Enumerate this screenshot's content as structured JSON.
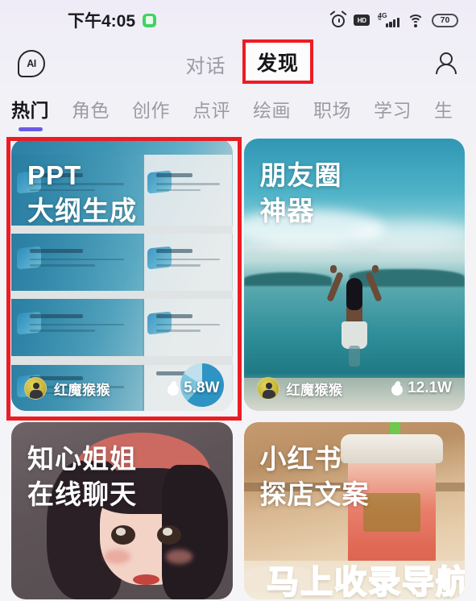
{
  "statusbar": {
    "time": "下午4:05",
    "app_badge_icon": "wechat-green-icon",
    "icons": [
      "alarm-icon",
      "hd-icon",
      "signal-4g-icon",
      "wifi-icon",
      "battery-icon"
    ],
    "network_label": "4G",
    "hd_label": "HD",
    "battery_level": "70"
  },
  "header": {
    "logo_text": "AI",
    "logo_icon": "ai-logo-icon",
    "profile_icon": "person-icon",
    "tabs": [
      {
        "label": "对话",
        "active": false
      },
      {
        "label": "发现",
        "active": true
      }
    ],
    "highlighted_tab": "发现"
  },
  "categories": [
    {
      "label": "热门",
      "active": true
    },
    {
      "label": "角色",
      "active": false
    },
    {
      "label": "创作",
      "active": false
    },
    {
      "label": "点评",
      "active": false
    },
    {
      "label": "绘画",
      "active": false
    },
    {
      "label": "职场",
      "active": false
    },
    {
      "label": "学习",
      "active": false
    },
    {
      "label": "生",
      "active": false
    }
  ],
  "cards": [
    {
      "title_line1": "PPT",
      "title_line2": "大纲生成",
      "author": "红魔猴猴",
      "hot_count": "5.8W",
      "hot_icon": "flame-icon",
      "avatar_icon": "avatar-icon",
      "highlighted": true
    },
    {
      "title_line1": "朋友圈",
      "title_line2": "神器",
      "author": "红魔猴猴",
      "hot_count": "12.1W",
      "hot_icon": "flame-icon",
      "avatar_icon": "avatar-icon",
      "highlighted": false
    },
    {
      "title_line1": "知心姐姐",
      "title_line2": "在线聊天",
      "author": "",
      "hot_count": "",
      "highlighted": false
    },
    {
      "title_line1": "小红书",
      "title_line2": "探店文案",
      "author": "",
      "hot_count": "",
      "highlighted": false
    }
  ],
  "watermark": {
    "text": "马上收录导航",
    "color": "#19b5a6"
  },
  "colors": {
    "accent_purple": "#6b5ce7",
    "annotation_red": "#ec1c24",
    "text_primary": "#16161a",
    "text_muted": "#9a9aa2"
  }
}
